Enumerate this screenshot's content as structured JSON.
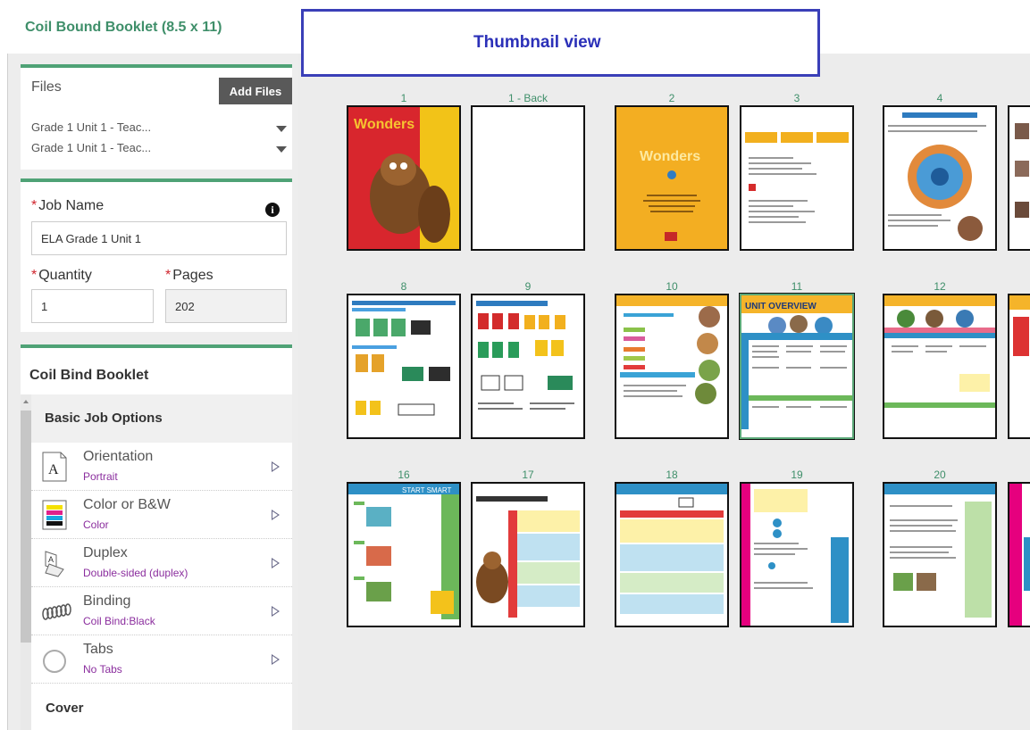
{
  "app": {
    "title": "Coil Bound Booklet (8.5 x 11)"
  },
  "callout": {
    "label": "Thumbnail view"
  },
  "files": {
    "header": "Files",
    "add_button": "Add Files",
    "items": [
      "Grade 1 Unit 1 - Teac...",
      "Grade 1 Unit 1 - Teac..."
    ]
  },
  "job": {
    "required_mark": "*",
    "name_label": "Job Name",
    "name_value": "ELA Grade 1 Unit 1",
    "quantity_label": "Quantity",
    "quantity_value": "1",
    "pages_label": "Pages",
    "pages_value": "202"
  },
  "booklet": {
    "title": "Coil Bind Booklet",
    "section": "Basic Job Options",
    "options": [
      {
        "name": "Orientation",
        "value": "Portrait",
        "icon": "orientation-a-icon"
      },
      {
        "name": "Color or B&W",
        "value": "Color",
        "icon": "color-bars-icon"
      },
      {
        "name": "Duplex",
        "value": "Double-sided (duplex)",
        "icon": "duplex-pages-icon"
      },
      {
        "name": "Binding",
        "value": "Coil Bind:Black",
        "icon": "coil-binding-icon"
      },
      {
        "name": "Tabs",
        "value": "No Tabs",
        "icon": "tabs-circle-icon"
      }
    ],
    "next_section": "Cover"
  },
  "thumbnails": {
    "rows": [
      [
        "1",
        "1 - Back",
        "2",
        "3",
        "4"
      ],
      [
        "8",
        "9",
        "10",
        "11",
        "12"
      ],
      [
        "16",
        "17",
        "18",
        "19",
        "20"
      ]
    ],
    "selected": "11",
    "colors": {
      "accent_green": "#3f8f6a",
      "selection": "#5aa877",
      "callout_blue": "#2b30b8"
    }
  }
}
